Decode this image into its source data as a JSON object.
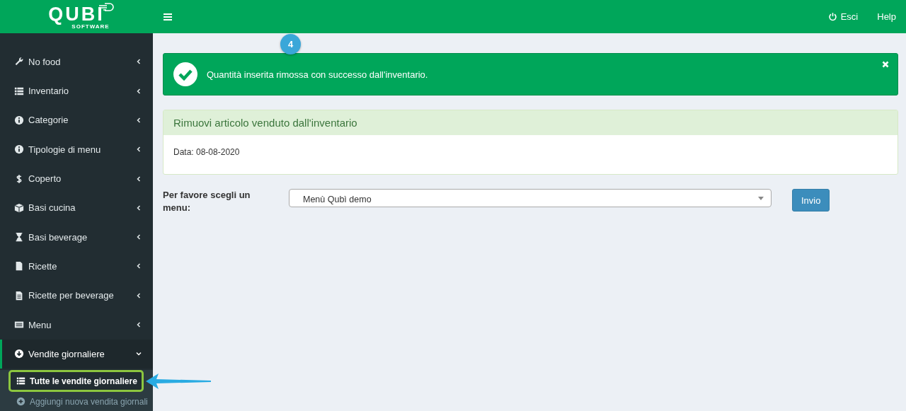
{
  "logo": {
    "name": "QUBI",
    "tagline": "SOFTWARE"
  },
  "sidebar": {
    "items": [
      {
        "label": "No food",
        "kind": "wrench",
        "expanded": false
      },
      {
        "label": "Inventario",
        "kind": "list",
        "expanded": false
      },
      {
        "label": "Categorie",
        "kind": "info",
        "expanded": false
      },
      {
        "label": "Tipologie di menu",
        "kind": "info",
        "expanded": false
      },
      {
        "label": "Coperto",
        "kind": "dollar",
        "expanded": false
      },
      {
        "label": "Basi cucina",
        "kind": "cube",
        "expanded": false
      },
      {
        "label": "Basi beverage",
        "kind": "hourglass",
        "expanded": false
      },
      {
        "label": "Ricette",
        "kind": "file",
        "expanded": false
      },
      {
        "label": "Ricette per beverage",
        "kind": "doc",
        "expanded": false
      },
      {
        "label": "Menu",
        "kind": "card",
        "expanded": false
      },
      {
        "label": "Vendite giornaliere",
        "kind": "download",
        "expanded": true,
        "children": [
          {
            "label": "Tutte le vendite giornaliere",
            "kind": "list",
            "selected": true
          },
          {
            "label": "Aggiungi nuova vendita giornali",
            "kind": "plus",
            "selected": false
          }
        ]
      }
    ]
  },
  "header": {
    "links": [
      {
        "label": "Esci",
        "kind": "power"
      },
      {
        "label": "Help",
        "kind": "text"
      }
    ]
  },
  "step_badge": "4",
  "alert": {
    "message": "Quantità inserita rimossa con successo dall'inventario."
  },
  "panel": {
    "title": "Rimuovi articolo venduto dall'inventario",
    "body": "Data: 08-08-2020"
  },
  "form": {
    "label": "Per favore scegli un menu:",
    "select_value": "Menù Qubì demo",
    "submit": "Invio"
  }
}
